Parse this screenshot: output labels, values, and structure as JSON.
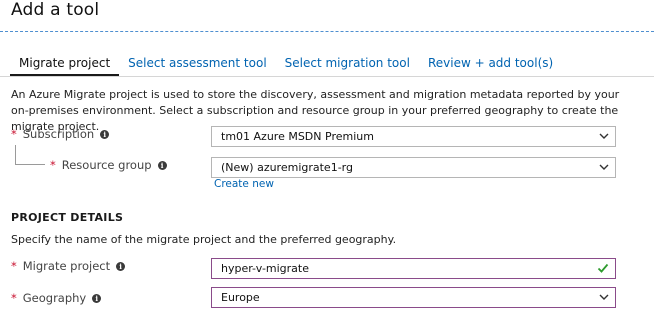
{
  "header": {
    "title": "Add a tool"
  },
  "tabs": [
    {
      "label": "Migrate project",
      "active": true
    },
    {
      "label": "Select assessment tool",
      "active": false
    },
    {
      "label": "Select migration tool",
      "active": false
    },
    {
      "label": "Review + add tool(s)",
      "active": false
    }
  ],
  "description": "An Azure Migrate project is used to store the discovery, assessment and migration metadata reported by your on-premises environment. Select a subscription and resource group in your preferred geography to create the migrate project.",
  "form": {
    "required_marker": "*",
    "subscription": {
      "label": "Subscription",
      "value": "tm01 Azure MSDN Premium"
    },
    "resource_group": {
      "label": "Resource group",
      "value": "(New) azuremigrate1-rg",
      "create_new": "Create new"
    }
  },
  "project_details": {
    "heading": "PROJECT DETAILS",
    "description": "Specify the name of the migrate project and the preferred geography.",
    "migrate_project": {
      "label": "Migrate project",
      "value": "hyper-v-migrate"
    },
    "geography": {
      "label": "Geography",
      "value": "Europe"
    }
  },
  "colors": {
    "link": "#0063b1",
    "required": "#c8102e",
    "valid": "#2e9b2e",
    "valid_border": "#8a4b8a"
  },
  "icons": {
    "info": "info-icon",
    "dropdown": "chevron-down-icon",
    "valid": "checkmark-icon"
  }
}
